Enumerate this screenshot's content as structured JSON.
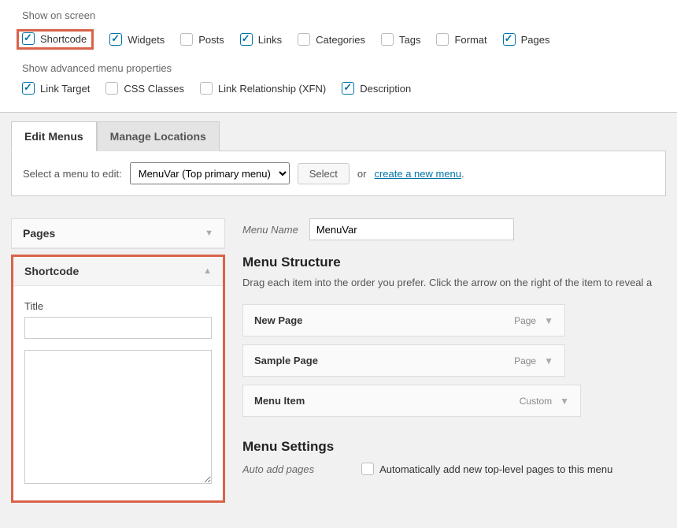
{
  "screenOptions": {
    "showOnScreenLabel": "Show on screen",
    "showAdvancedLabel": "Show advanced menu properties",
    "screenItems": [
      {
        "label": "Shortcode",
        "checked": true,
        "highlight": true
      },
      {
        "label": "Widgets",
        "checked": true
      },
      {
        "label": "Posts",
        "checked": false
      },
      {
        "label": "Links",
        "checked": true
      },
      {
        "label": "Categories",
        "checked": false
      },
      {
        "label": "Tags",
        "checked": false
      },
      {
        "label": "Format",
        "checked": false
      },
      {
        "label": "Pages",
        "checked": true
      }
    ],
    "advancedItems": [
      {
        "label": "Link Target",
        "checked": true
      },
      {
        "label": "CSS Classes",
        "checked": false
      },
      {
        "label": "Link Relationship (XFN)",
        "checked": false
      },
      {
        "label": "Description",
        "checked": true
      }
    ]
  },
  "tabs": {
    "edit": "Edit Menus",
    "manage": "Manage Locations"
  },
  "selectBar": {
    "label": "Select a menu to edit:",
    "selected": "MenuVar (Top primary menu)",
    "selectBtn": "Select",
    "orText": "or",
    "createLink": "create a new menu",
    "dot": "."
  },
  "sidebar": {
    "pagesTitle": "Pages",
    "shortcodeTitle": "Shortcode",
    "titleLabel": "Title"
  },
  "main": {
    "menuNameLabel": "Menu Name",
    "menuNameValue": "MenuVar",
    "structureHeading": "Menu Structure",
    "structureHelp": "Drag each item into the order you prefer. Click the arrow on the right of the item to reveal a",
    "items": [
      {
        "label": "New Page",
        "type": "Page"
      },
      {
        "label": "Sample Page",
        "type": "Page"
      },
      {
        "label": "Menu Item",
        "type": "Custom"
      }
    ],
    "settingsHeading": "Menu Settings",
    "autoAddLabel": "Auto add pages",
    "autoAddCheckbox": "Automatically add new top-level pages to this menu"
  }
}
